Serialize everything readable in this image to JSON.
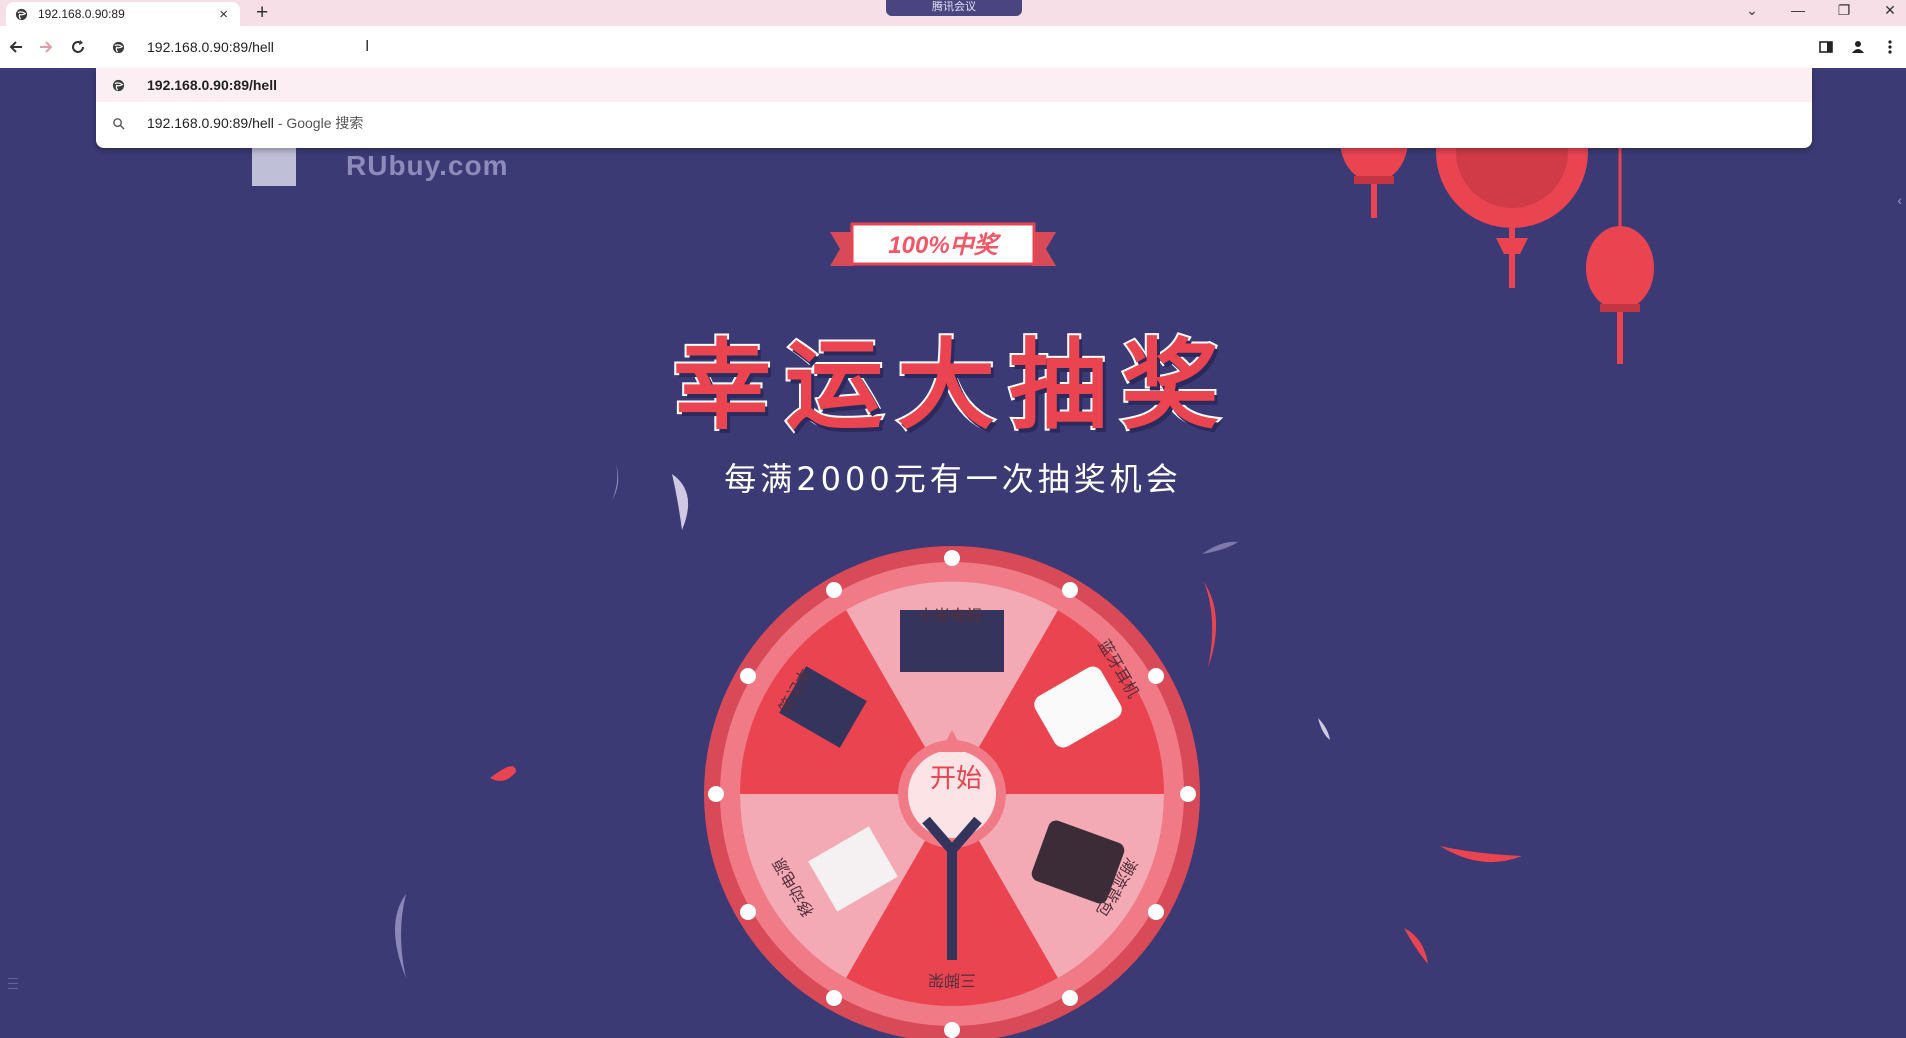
{
  "browser": {
    "tab_title": "192.168.0.90:89",
    "new_tab_label": "+",
    "tab_close_label": "×",
    "meeting_label": "腾讯会议",
    "window_controls": {
      "list": "⌄",
      "minimize": "—",
      "restore": "❐",
      "close": "✕"
    },
    "address": "192.168.0.90:89/hell",
    "suggestions": [
      {
        "text": "192.168.0.90:89/hell",
        "suffix": "",
        "icon": "globe-icon"
      },
      {
        "text": "192.168.0.90:89/hell",
        "suffix": " - Google 搜索",
        "icon": "search-icon"
      }
    ]
  },
  "page": {
    "logo_text": "RUbuy.com",
    "banner": "100%中奖",
    "title": "幸运大抽奖",
    "subtitle": "每满2000元有一次抽奖机会",
    "start_button": "开始",
    "prizes": [
      "小米电视",
      "蓝牙耳机",
      "潮流背包",
      "三脚架",
      "移动电源",
      "笔记本"
    ]
  },
  "colors": {
    "background": "#3b3a75",
    "accent_red": "#ea4451",
    "wheel_light": "#f3aab4",
    "tab_bar": "#f6dfe6"
  }
}
